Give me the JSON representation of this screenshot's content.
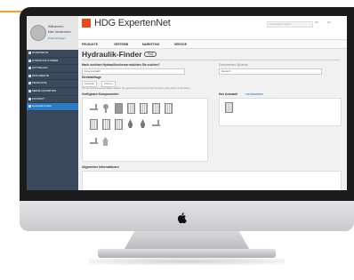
{
  "app": {
    "logo_text": "HDG ExpertenNet",
    "search_placeholder": "Suchbegriff eingeben",
    "top_links": [
      "DE",
      "EN"
    ]
  },
  "user": {
    "line1": "Willkommen",
    "line2": "Marc Mustermann",
    "link": "Profil anzeigen"
  },
  "sidebar": {
    "items": [
      {
        "label": "STARTSEITE",
        "active": false
      },
      {
        "label": "HYDRAULIK-FINDER",
        "active": false
      },
      {
        "label": "AKTUELLES",
        "active": false
      },
      {
        "label": "DOKUMENTE",
        "active": false
      },
      {
        "label": "PRODUKTE",
        "active": false
      },
      {
        "label": "MEINE FAVORITEN",
        "active": false
      },
      {
        "label": "KONTAKT",
        "active": false
      },
      {
        "label": "Hydraulik-Finder",
        "active": true
      }
    ]
  },
  "nav": {
    "items": [
      "PRODUKTE",
      "VERTRIEB",
      "MARKETING",
      "SERVICE"
    ]
  },
  "page": {
    "title": "Hydraulik-Finder",
    "faq_label": "FAQ",
    "q1": "Nach welchen Hydraulikschema möchten Sie suchen?",
    "q1_value": "Freie Auswahl",
    "q2": "Dokumenten Sprache",
    "q2_value": "Deutsch",
    "q3": "Direktabfrage",
    "chip1": "Hydraulik",
    "chip2": "Schema",
    "hint": "Um die Suche einzuschränken wählen Sie gewünschten Komponenten anhand in das andere Feld ziehen.",
    "components_label": "Verfügbare Komponenten",
    "selection_label": "Ihre Auswahl",
    "selection_link": "zurücksetzen",
    "general_label": "Allgemeine Informationen"
  },
  "components": [
    "pipe-icon",
    "valve-icon",
    "boiler-icon",
    "radiator-icon",
    "radiator-icon",
    "radiator-icon",
    "radiator-icon",
    "radiator-icon",
    "radiator-icon",
    "radiator-icon",
    "flame-icon",
    "flame-icon",
    "pipe-icon",
    "pipe-icon",
    "house-icon"
  ]
}
